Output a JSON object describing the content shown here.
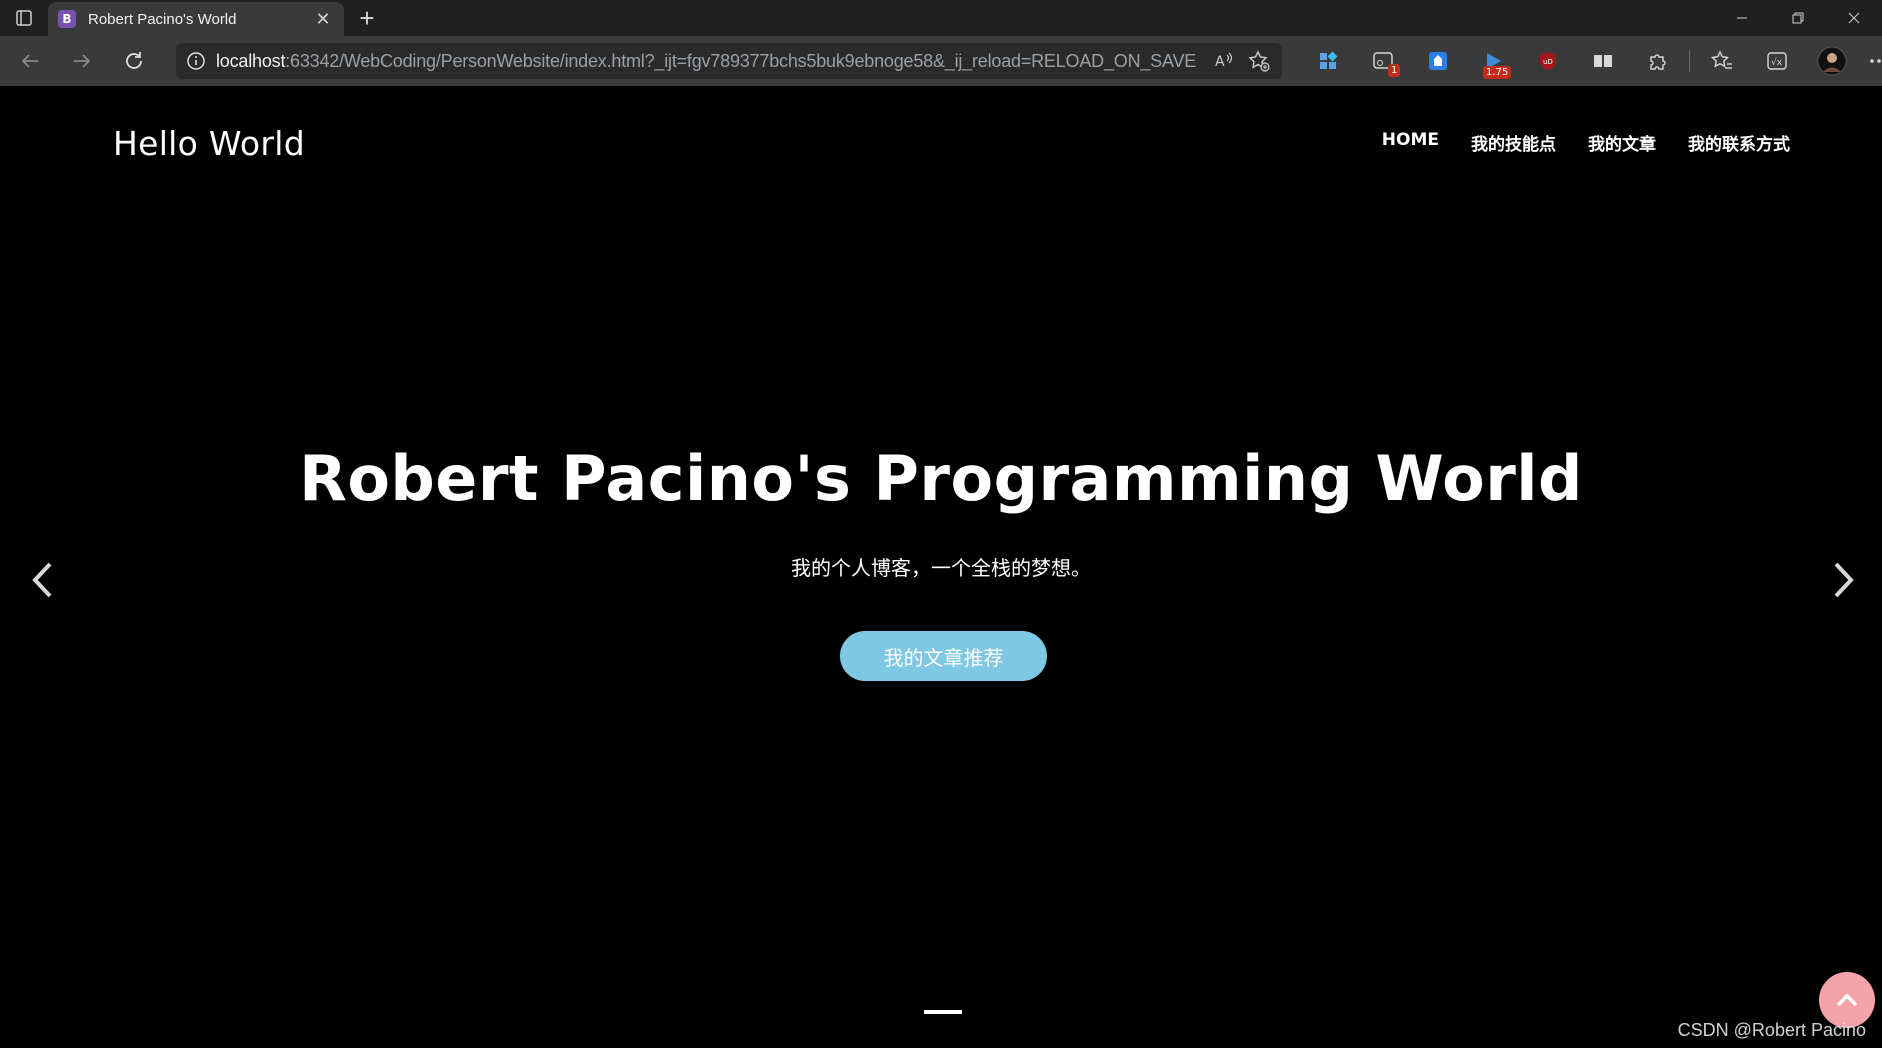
{
  "browser": {
    "tab": {
      "favicon_letter": "B",
      "title": "Robert Pacino's World"
    },
    "address": {
      "host": "localhost",
      "rest": ":63342/WebCoding/PersonWebsite/index.html?_ijt=fgv789377bchs5buk9ebnoge58&_ij_reload=RELOAD_ON_SAVE"
    },
    "extensions": [
      {
        "name": "apps-icon"
      },
      {
        "name": "extension-icon",
        "badge": "1"
      },
      {
        "name": "extension-icon"
      },
      {
        "name": "video-speed-icon",
        "badge": "1.75"
      },
      {
        "name": "ublock-icon"
      },
      {
        "name": "reading-icon"
      }
    ],
    "colors": {
      "tabbar": "#202020",
      "toolbar": "#3a3a3a"
    }
  },
  "site": {
    "brand": "Hello World",
    "nav": [
      "HOME",
      "我的技能点",
      "我的文章",
      "我的联系方式"
    ],
    "hero": {
      "title": "Robert Pacino's Programming World",
      "subtitle": "我的个人博客，一个全栈的梦想。",
      "button": "我的文章推荐"
    },
    "watermark": "CSDN @Robert Pacino",
    "colors": {
      "background": "#000000",
      "button": "#7ec8e3",
      "back_to_top": "#f4a3a8"
    }
  }
}
